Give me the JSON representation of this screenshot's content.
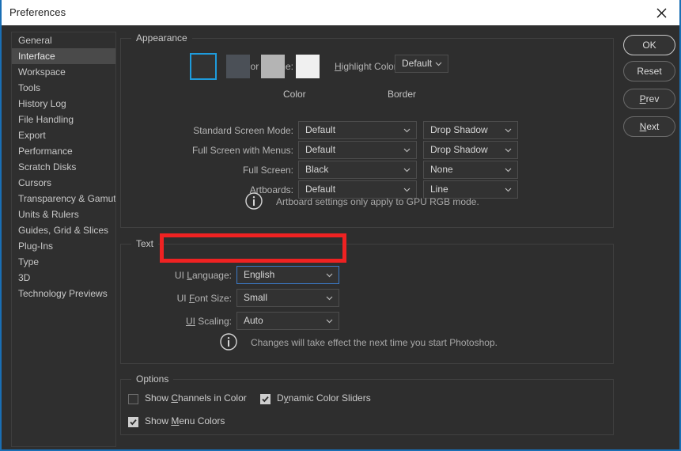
{
  "window": {
    "title": "Preferences",
    "close_icon": "close-icon"
  },
  "sidebar": {
    "items": [
      {
        "label": "General",
        "selected": false
      },
      {
        "label": "Interface",
        "selected": true
      },
      {
        "label": "Workspace",
        "selected": false
      },
      {
        "label": "Tools",
        "selected": false
      },
      {
        "label": "History Log",
        "selected": false
      },
      {
        "label": "File Handling",
        "selected": false
      },
      {
        "label": "Export",
        "selected": false
      },
      {
        "label": "Performance",
        "selected": false
      },
      {
        "label": "Scratch Disks",
        "selected": false
      },
      {
        "label": "Cursors",
        "selected": false
      },
      {
        "label": "Transparency & Gamut",
        "selected": false
      },
      {
        "label": "Units & Rulers",
        "selected": false
      },
      {
        "label": "Guides, Grid & Slices",
        "selected": false
      },
      {
        "label": "Plug-Ins",
        "selected": false
      },
      {
        "label": "Type",
        "selected": false
      },
      {
        "label": "3D",
        "selected": false
      },
      {
        "label": "Technology Previews",
        "selected": false
      }
    ]
  },
  "appearance": {
    "legend": "Appearance",
    "color_theme_label": "Color Theme:",
    "swatches": [
      {
        "name": "theme-dark",
        "color": "#323232",
        "selected": true
      },
      {
        "name": "theme-medium-dark",
        "color": "#4b5057",
        "selected": false
      },
      {
        "name": "theme-light-gray",
        "color": "#b4b4b4",
        "selected": false
      },
      {
        "name": "theme-white",
        "color": "#f0f0f0",
        "selected": false
      }
    ],
    "highlight_color_label": "Highlight Color:",
    "highlight_color_value": "Default",
    "column_headers": {
      "color": "Color",
      "border": "Border"
    },
    "rows": [
      {
        "label": "Standard Screen Mode:",
        "color": "Default",
        "border": "Drop Shadow"
      },
      {
        "label": "Full Screen with Menus:",
        "color": "Default",
        "border": "Drop Shadow"
      },
      {
        "label": "Full Screen:",
        "color": "Black",
        "border": "None"
      },
      {
        "label": "Artboards:",
        "color": "Default",
        "border": "Line"
      }
    ],
    "info": {
      "icon": "info-icon",
      "text": "Artboard settings only apply to GPU RGB mode."
    }
  },
  "text_section": {
    "legend": "Text",
    "rows": [
      {
        "label_pre": "UI ",
        "label_mn": "L",
        "label_post": "anguage:",
        "value": "English",
        "focused": true
      },
      {
        "label_pre": "UI ",
        "label_mn": "F",
        "label_post": "ont Size:",
        "value": "Small",
        "focused": false
      },
      {
        "label_pre": "",
        "label_mn": "UI",
        "label_post": " Scaling:",
        "value": "Auto",
        "focused": false
      }
    ],
    "info": {
      "icon": "info-icon",
      "text": "Changes will take effect the next time you start Photoshop."
    }
  },
  "options": {
    "legend": "Options",
    "checkboxes": [
      {
        "pre": "Show ",
        "mn": "C",
        "post": "hannels in Color",
        "checked": false
      },
      {
        "pre": "D",
        "mn": "y",
        "post": "namic Color Sliders",
        "checked": true
      },
      {
        "pre": "Show ",
        "mn": "M",
        "post": "enu Colors",
        "checked": true
      }
    ]
  },
  "buttons": [
    {
      "pre": "",
      "mn": "",
      "post": "OK",
      "primary": true
    },
    {
      "pre": "",
      "mn": "",
      "post": "Reset",
      "primary": false
    },
    {
      "pre": "",
      "mn": "P",
      "post": "rev",
      "primary": false
    },
    {
      "pre": "",
      "mn": "N",
      "post": "ext",
      "primary": false
    }
  ],
  "annotation": {
    "color": "#ef2222",
    "target": "ui-language-row"
  }
}
